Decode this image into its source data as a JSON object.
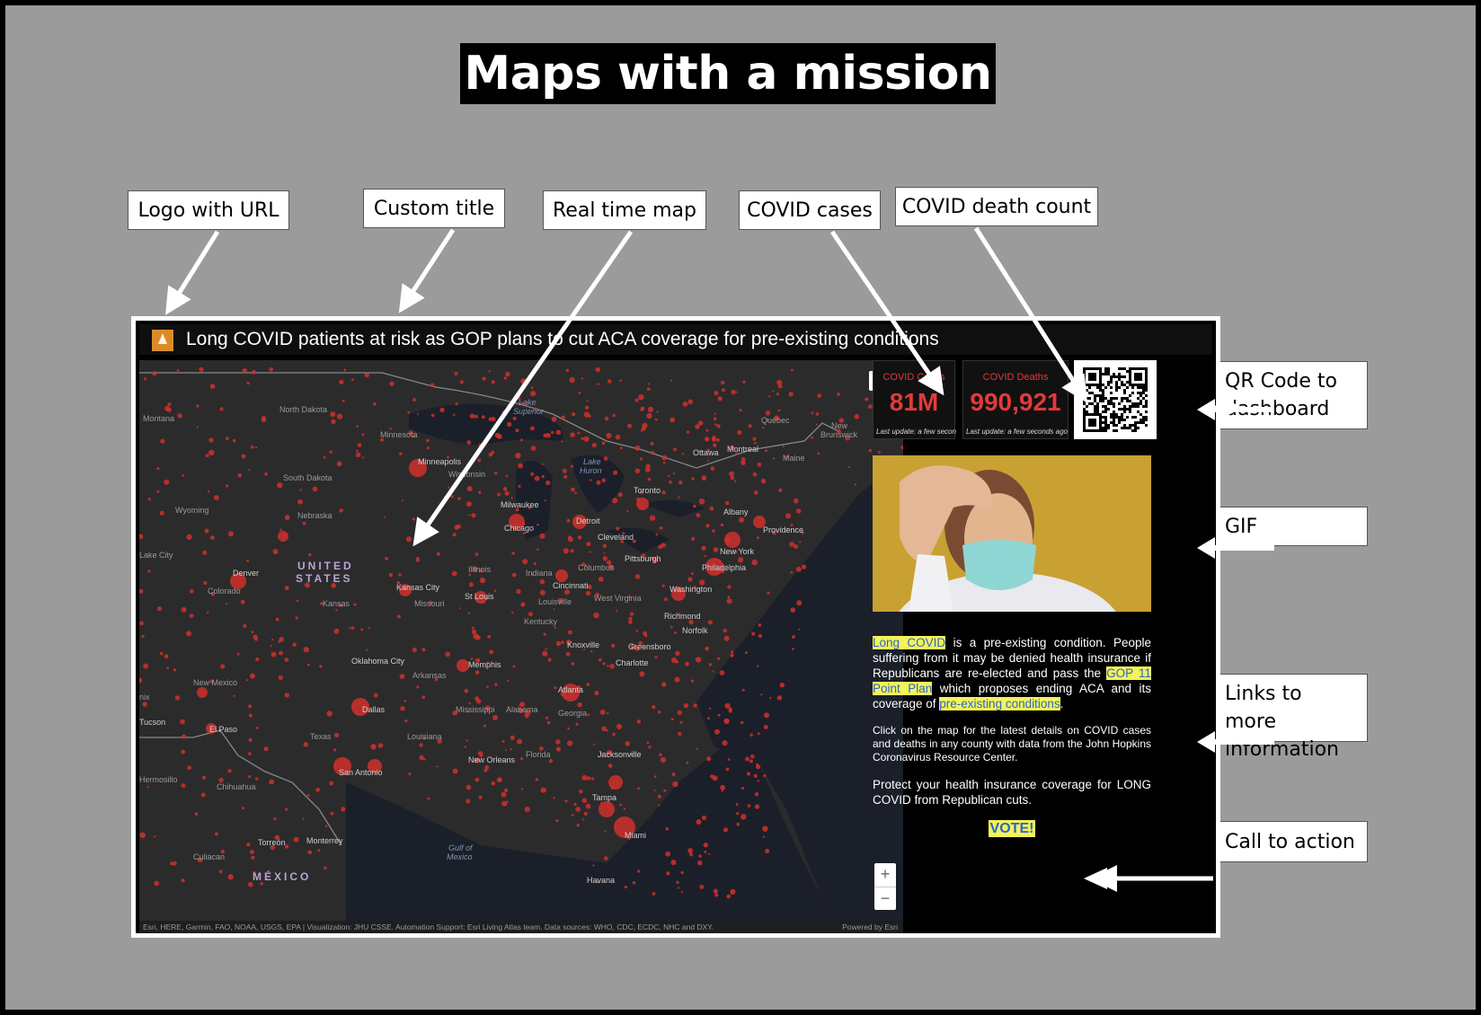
{
  "slide": {
    "title": "Maps with a mission"
  },
  "callouts": {
    "logo": "Logo with URL",
    "custom_title": "Custom title",
    "real_time_map": "Real time map",
    "covid_cases": "COVID cases",
    "covid_death_count": "COVID death count",
    "qr_code_line1": "QR Code to",
    "qr_code_line2": "dashboard",
    "gif": "GIF",
    "links_line1": "Links to more",
    "links_line2": "information",
    "call_to_action": "Call to action"
  },
  "dashboard": {
    "title": "Long COVID patients at risk as GOP plans to cut ACA coverage for pre-existing conditions",
    "cases": {
      "label": "COVID Cases",
      "value": "81M",
      "updated": "Last update: a few secon"
    },
    "deaths": {
      "label": "COVID Deaths",
      "value": "990,921",
      "updated": "Last update: a few seconds ago"
    },
    "info": {
      "p1_link1": "Long COVID",
      "p1_text1": " is a pre-existing condition. People suffering from it may be denied health insurance if Republicans are re-elected and pass the ",
      "p1_link2": "GOP 11 Point Plan",
      "p1_text2": " which proposes ending ACA and its coverage of ",
      "p1_link3": "pre-existing conditions",
      "p1_text3": ".",
      "p2": "Click on the map for the latest details on COVID cases and deaths in any county with data from the John Hopkins Coronavirus Resource Center.",
      "p3": "Protect your health insurance coverage for LONG COVID from Republican cuts.",
      "vote": "VOTE!"
    }
  },
  "map": {
    "search_icon": "search-icon",
    "zoom_in": "+",
    "zoom_out": "−",
    "attribution": "Esri, HERE, Garmin, FAO, NOAA, USGS, EPA | Visualization: JHU CSSE. Automation Support: Esri Living Atlas team. Data sources: WHO, CDC, ECDC, NHC and DXY.",
    "powered_by": "Powered by Esri",
    "labels": {
      "montana": "Montana",
      "north_dakota": "North Dakota",
      "minnesota": "Minnesota",
      "south_dakota": "South Dakota",
      "wyoming": "Wyoming",
      "nebraska": "Nebraska",
      "salt_lake": "Lake City",
      "colorado": "Colorado",
      "denver": "Denver",
      "kansas": "Kansas",
      "kansas_city": "Kansas City",
      "missouri": "Missouri",
      "st_louis": "St Louis",
      "oklahoma_city": "Oklahoma City",
      "arkansas": "Arkansas",
      "new_mexico": "New Mexico",
      "texas": "Texas",
      "dallas": "Dallas",
      "el_paso": "El Paso",
      "tucson": "Tucson",
      "nix": "nix",
      "san_antonio": "San Antonio",
      "hermosillo": "Hermosillo",
      "chihuahua": "Chihuahua",
      "monterrey": "Monterrey",
      "torreon": "Torreón",
      "culiacan": "Culiacan",
      "mexico": "MÉXICO",
      "united_states_1": "UNITED",
      "united_states_2": "STATES",
      "lake_superior_1": "Lake",
      "lake_superior_2": "Superior",
      "lake_huron_1": "Lake",
      "lake_huron_2": "Huron",
      "minneapolis": "Minneapolis",
      "wisconsin": "Wisconsin",
      "milwaukee": "Milwaukee",
      "chicago": "Chicago",
      "detroit": "Detroit",
      "cleveland": "Cleveland",
      "toronto": "Toronto",
      "ottawa": "Ottawa",
      "montreal": "Montreal",
      "quebec": "Québec",
      "new_brunswick_1": "New",
      "new_brunswick_2": "Brunswick",
      "maine": "Maine",
      "albany": "Albany",
      "new_york": "New York",
      "providence": "Providence",
      "philadelphia": "Philadelphia",
      "pittsburgh": "Pittsburgh",
      "columbus": "Columbus",
      "cincinnati": "Cincinnati",
      "indiana": "Indiana",
      "illinois": "Illinois",
      "louisville": "Louisville",
      "west_virginia": "West Virginia",
      "washington": "Washington",
      "richmond": "Richmond",
      "norfolk": "Norfolk",
      "kentucky": "Kentucky",
      "knoxville": "Knoxville",
      "greensboro": "Greensboro",
      "charlotte": "Charlotte",
      "memphis": "Memphis",
      "atlanta": "Atlanta",
      "mississippi": "Mississippi",
      "alabama": "Alabama",
      "georgia": "Georgia",
      "louisiana": "Louisiana",
      "new_orleans": "New Orleans",
      "florida": "Florida",
      "jacksonville": "Jacksonville",
      "tampa": "Tampa",
      "miami": "Miami",
      "gulf_1": "Gulf of",
      "gulf_2": "Mexico",
      "havana": "Havana"
    }
  },
  "colors": {
    "background": "#9b9b9b",
    "dot": "#d0302c",
    "map_land": "#2b2b2c",
    "map_water": "#1b1f29",
    "highlight": "#f3f35a",
    "stat_red": "#e23a3a"
  }
}
